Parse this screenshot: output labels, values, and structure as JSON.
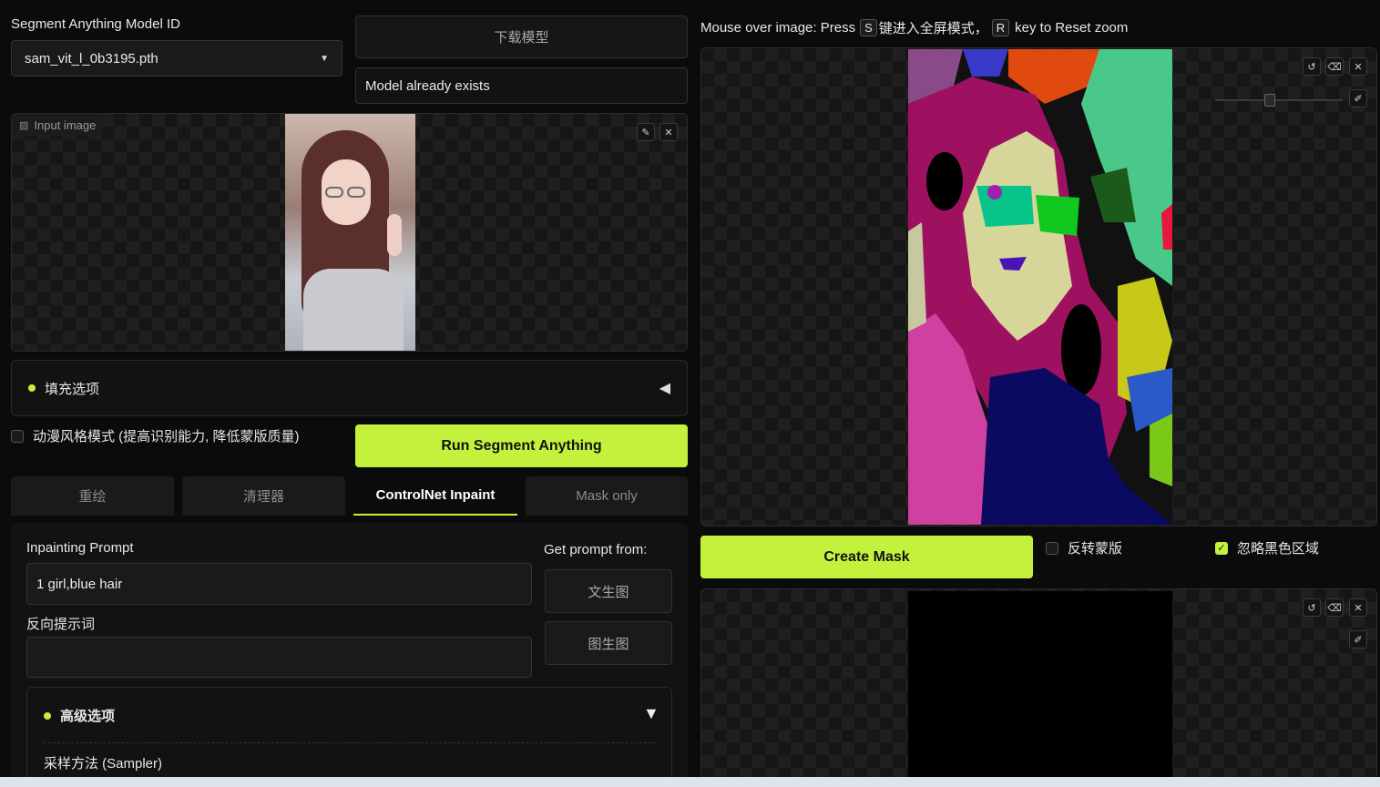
{
  "model": {
    "label": "Segment Anything Model ID",
    "selected": "sam_vit_l_0b3195.pth",
    "download_button": "下载模型",
    "status": "Model already exists"
  },
  "input_image": {
    "label": "Input image"
  },
  "fill_options": {
    "label": "填充选项"
  },
  "anime_mode": {
    "label": "动漫风格模式 (提高识别能力, 降低蒙版质量)",
    "checked": false
  },
  "run_button": "Run Segment Anything",
  "tabs": [
    {
      "label": "重绘",
      "active": false
    },
    {
      "label": "清理器",
      "active": false
    },
    {
      "label": "ControlNet Inpaint",
      "active": true
    },
    {
      "label": "Mask only",
      "active": false
    }
  ],
  "inpaint": {
    "prompt_label": "Inpainting Prompt",
    "prompt_value": "1 girl,blue hair",
    "get_prompt_label": "Get prompt from:",
    "txt2img_button": "文生图",
    "img2img_button": "图生图",
    "negative_label": "反向提示词",
    "negative_value": "",
    "advanced_label": "高级选项",
    "sampler_label": "采样方法 (Sampler)"
  },
  "hint": {
    "prefix": "Mouse over image: Press",
    "key1": "S",
    "middle": "键进入全屏模式，",
    "key2": "R",
    "suffix": "key to Reset zoom"
  },
  "create_mask_button": "Create Mask",
  "invert_mask": {
    "label": "反转蒙版",
    "checked": false
  },
  "ignore_black": {
    "label": "忽略黑色区域",
    "checked": true
  },
  "colors": {
    "accent": "#c4f23c",
    "background": "#0b0b0b"
  }
}
